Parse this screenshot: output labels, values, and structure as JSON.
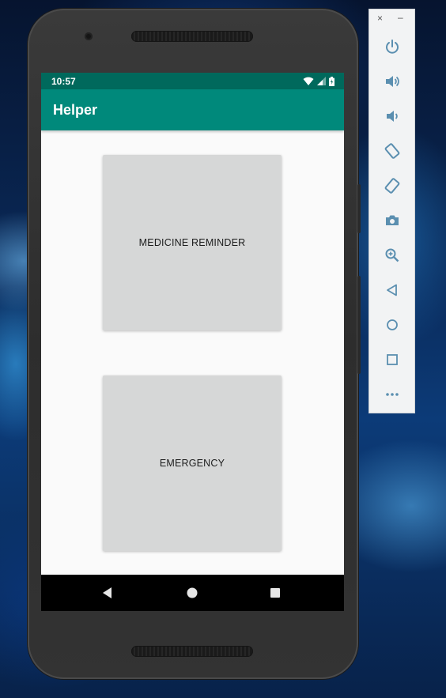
{
  "status_bar": {
    "time": "10:57"
  },
  "app_bar": {
    "title": "Helper"
  },
  "main": {
    "tiles": [
      {
        "label": "MEDICINE REMINDER"
      },
      {
        "label": "EMERGENCY"
      }
    ]
  },
  "nav_bar": {
    "icons": [
      "back-icon",
      "home-icon",
      "recents-icon"
    ]
  },
  "emulator_toolbar": {
    "close_label": "×",
    "minimize_label": "–",
    "icons": [
      "power-icon",
      "volume-up-icon",
      "volume-down-icon",
      "rotate-left-icon",
      "rotate-right-icon",
      "camera-icon",
      "zoom-icon",
      "back-icon",
      "home-icon",
      "overview-icon",
      "more-icon"
    ]
  },
  "colors": {
    "status_bar": "#00695c",
    "app_bar": "#00897b",
    "tile": "#d6d7d7",
    "screen_bg": "#fafafa",
    "toolbar_icon": "#5b8fb0"
  }
}
